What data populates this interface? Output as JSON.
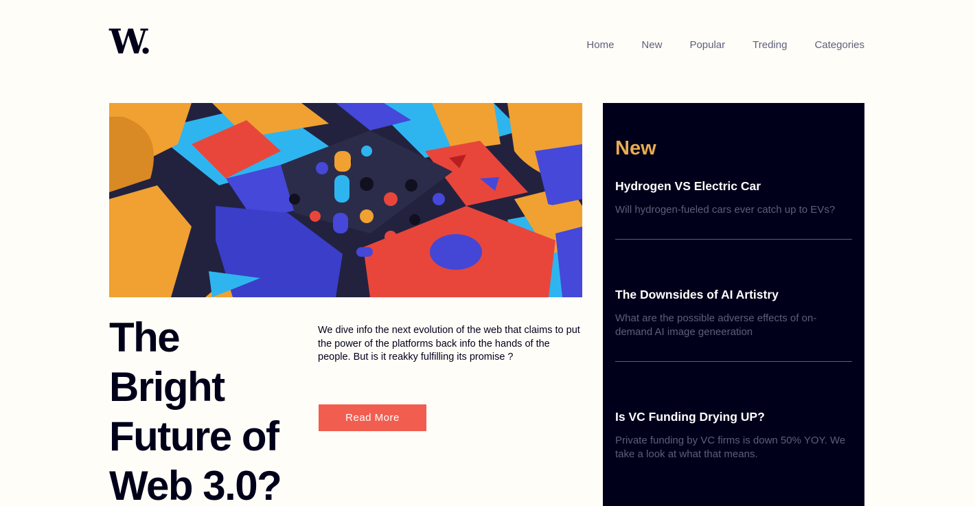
{
  "header": {
    "logo": "W.",
    "nav": [
      "Home",
      "New",
      "Popular",
      "Treding",
      "Categories"
    ]
  },
  "hero": {
    "title_lines": [
      "The",
      "Bright",
      "Future of",
      "Web 3.0?"
    ],
    "intro": "We dive info the next evolution of the web that claims to put the power of the platforms back info the hands of the people. But is it reakky fulfilling its promise ?",
    "cta": "Read More"
  },
  "sidebar": {
    "title": "New",
    "articles": [
      {
        "title": "Hydrogen VS Electric Car",
        "summary": "Will hydrogen-fueled cars ever catch up to EVs?"
      },
      {
        "title": "The Downsides of AI Artistry",
        "summary": "What are the possible adverse effects of on-demand AI image geneeration"
      },
      {
        "title": "Is VC Funding Drying UP?",
        "summary": "Private funding by VC firms is down 50% YOY. We take a look at what that means."
      }
    ]
  },
  "colors": {
    "background": "#fffdf8",
    "dark": "#00001a",
    "accent_orange": "#e9ab53",
    "cta_red": "#f15e50",
    "muted": "#5d5f79"
  }
}
